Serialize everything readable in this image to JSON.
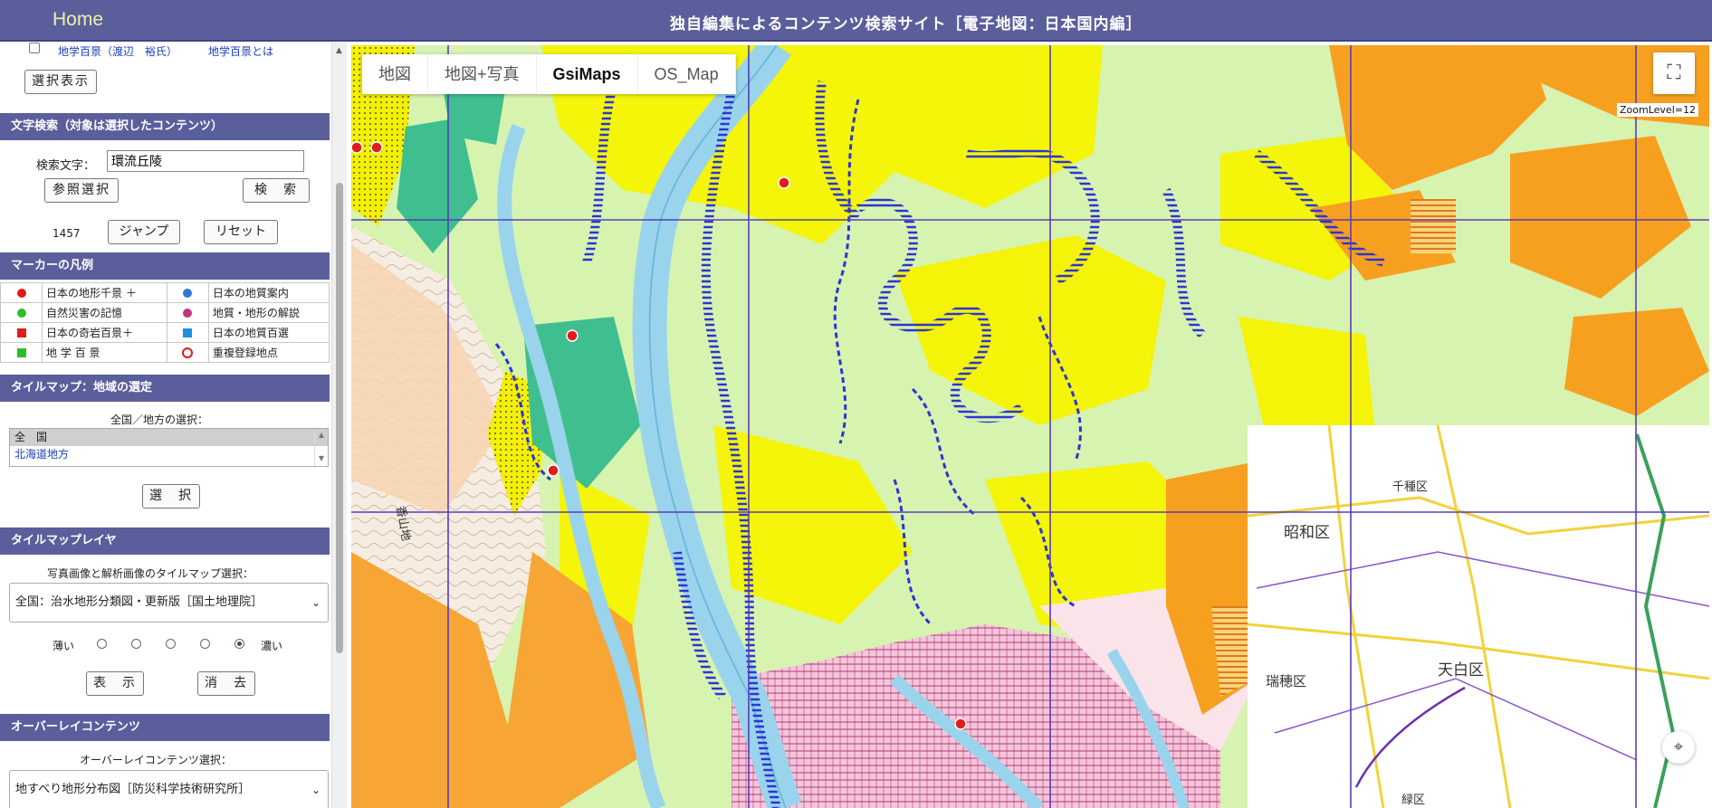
{
  "header": {
    "home": "Home",
    "title": "独自編集によるコンテンツ検索サイト［電子地図：日本国内編］"
  },
  "contents": {
    "item_label": "地学百景（渡辺　裕氏）",
    "item_link": "地学百景とは",
    "select_button": "選択表示"
  },
  "text_search": {
    "heading": "文字検索（対象は選択したコンテンツ）",
    "label": "検索文字：",
    "value": "環流丘陵",
    "browse_button": "参照選択",
    "search_button": "検　索",
    "count": "1457",
    "jump_button": "ジャンプ",
    "reset_button": "リセット"
  },
  "legend": {
    "heading": "マーカーの凡例",
    "rows": [
      [
        {
          "label": "日本の地形千景 ＋",
          "color": "#e31b1b",
          "shape": "circle"
        },
        {
          "label": "日本の地質案内",
          "color": "#2a7bd8",
          "shape": "circle"
        }
      ],
      [
        {
          "label": "自然災害の記憶",
          "color": "#2bbd2b",
          "shape": "circle"
        },
        {
          "label": "地質・地形の解説",
          "color": "#c8327a",
          "shape": "circle"
        }
      ],
      [
        {
          "label": "日本の奇岩百景＋",
          "color": "#e31b1b",
          "shape": "square"
        },
        {
          "label": "日本の地質百選",
          "color": "#1e8fe0",
          "shape": "square"
        }
      ],
      [
        {
          "label": "地 学 百 景",
          "color": "#2bbd2b",
          "shape": "square"
        },
        {
          "label": "重複登録地点",
          "color": "#e31b1b",
          "shape": "ring"
        }
      ]
    ]
  },
  "tile_region": {
    "heading": "タイルマップ：地域の選定",
    "label": "全国／地方の選択：",
    "options": [
      "全　国",
      "北海道地方"
    ],
    "select_button": "選　択"
  },
  "tile_layer": {
    "heading": "タイルマップレイヤ",
    "label": "写真画像と解析画像のタイルマップ選択：",
    "selected": "全国：治水地形分類図・更新版［国土地理院］",
    "light": "薄い",
    "dark": "濃い",
    "opacity_level": 5,
    "show_button": "表　示",
    "clear_button": "消　去"
  },
  "overlay": {
    "heading": "オーバーレイコンテンツ",
    "label": "オーバーレイコンテンツ選択：",
    "selected": "地すべり地形分布図［防災科学技術研究所］"
  },
  "map": {
    "tabs": [
      "地図",
      "地図+写真",
      "GsiMaps",
      "OS_Map"
    ],
    "active_tab": "GsiMaps",
    "zoom_level": "ZoomLevel=12",
    "labels": [
      "昭和区",
      "瑞穂区",
      "天白区",
      "千種区",
      "緑区",
      "香山地"
    ]
  }
}
